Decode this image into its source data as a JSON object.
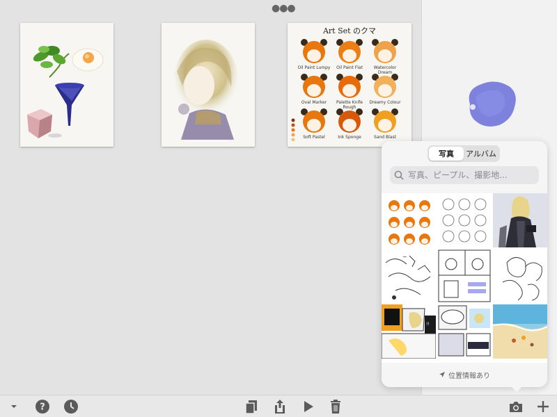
{
  "gallery": {
    "artworks": [
      {
        "name": "watercolor still life"
      },
      {
        "name": "watercolor portrait"
      },
      {
        "name": "art set reference sheet",
        "title": "Art Set のクマ",
        "labels": [
          "Oil Paint Lumpy",
          "Oil Paint Flat",
          "Watercolor Dream",
          "Oval Marker",
          "Palette Knife Rough",
          "Dreamy Colour",
          "Soft Pastel",
          "Ink Sponge",
          "Sand Blast"
        ]
      }
    ]
  },
  "popover": {
    "tabs": [
      "写真",
      "アルバム"
    ],
    "selected_tab": "写真",
    "search_placeholder": "写真、ピープル、撮影地...",
    "footer_text": "位置情報あり"
  },
  "toolbar": {
    "left_icons": [
      "chevron-down-icon",
      "help-icon",
      "clock-icon"
    ],
    "center_icons": [
      "copy-icon",
      "share-icon",
      "play-icon",
      "trash-icon"
    ],
    "right_icons": [
      "camera-icon",
      "plus-icon"
    ]
  },
  "colors": {
    "background": "#e3e3e3",
    "toolbar_icon": "#5a5a5a",
    "popover": "#f5f5f5",
    "orange_hair": "#e8770e",
    "blue_paint": "#6a6fd8"
  }
}
